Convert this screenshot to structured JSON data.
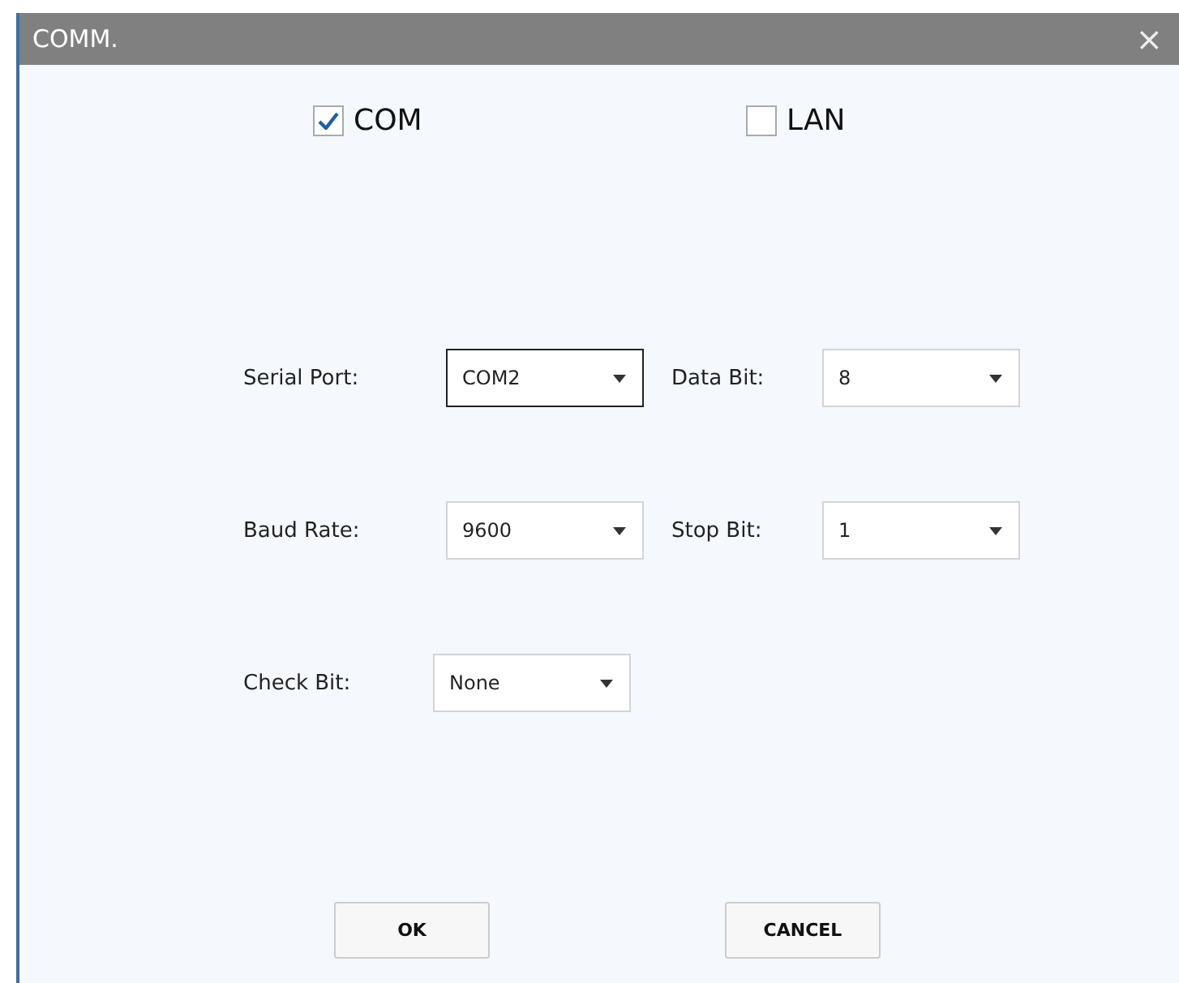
{
  "window": {
    "title": "COMM.",
    "close": "×"
  },
  "modes": [
    {
      "label": "COM",
      "checked": true
    },
    {
      "label": "LAN",
      "checked": false
    }
  ],
  "rows": [
    [
      {
        "label": "Serial Port:",
        "value": "COM2",
        "focused": true
      },
      {
        "label": "Data Bit:",
        "value": "8",
        "focused": false
      }
    ],
    [
      {
        "label": "Baud Rate:",
        "value": "9600",
        "focused": false
      },
      {
        "label": "Stop Bit:",
        "value": "1",
        "focused": false
      }
    ],
    [
      {
        "label": "Check Bit:",
        "value": "None",
        "focused": false
      }
    ]
  ],
  "buttons": [
    "OK",
    "CANCEL"
  ]
}
